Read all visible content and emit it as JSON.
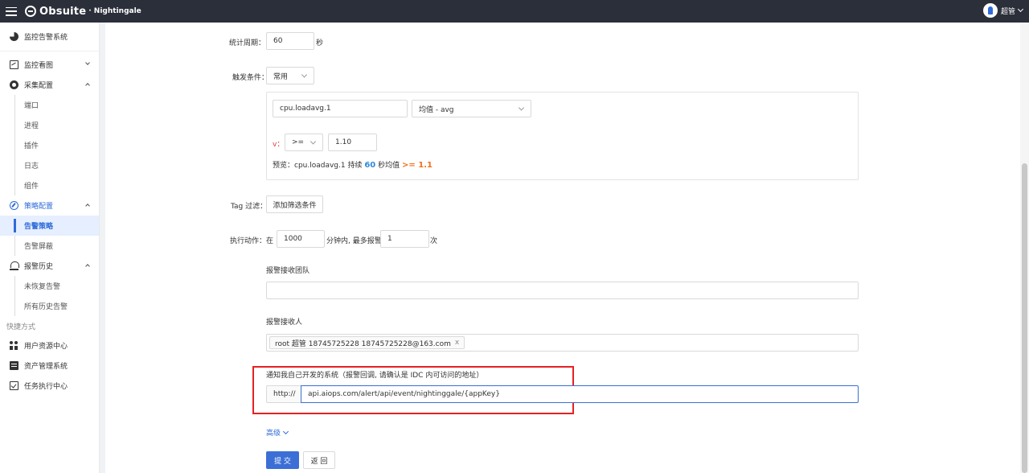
{
  "header": {
    "brand": "Obsuite",
    "brand_sub": "· Nightingale",
    "user_name": "超管"
  },
  "sidebar": {
    "title": "监控告警系统",
    "groups": [
      {
        "label": "监控看图",
        "icon": "chart-monitor-icon",
        "expanded": false
      },
      {
        "label": "采集配置",
        "icon": "collect-icon",
        "expanded": true,
        "items": [
          "端口",
          "进程",
          "插件",
          "日志",
          "组件"
        ]
      },
      {
        "label": "策略配置",
        "icon": "compass-icon",
        "expanded": true,
        "active": true,
        "items": [
          "告警策略",
          "告警屏蔽"
        ],
        "active_item": "告警策略"
      },
      {
        "label": "报警历史",
        "icon": "history-icon",
        "expanded": true,
        "items": [
          "未恢复告警",
          "所有历史告警"
        ]
      }
    ],
    "shortcut_label": "快捷方式",
    "shortcuts": [
      {
        "label": "用户资源中心",
        "icon": "users-icon"
      },
      {
        "label": "资产管理系统",
        "icon": "asset-icon"
      },
      {
        "label": "任务执行中心",
        "icon": "task-icon"
      }
    ]
  },
  "form": {
    "period_label": "统计周期：",
    "period_value": "60",
    "period_unit": "秒",
    "trigger_label": "触发条件：",
    "trigger_mode": "常用",
    "metric": "cpu.loadavg.1",
    "func": "均值 - avg",
    "v_label": "v：",
    "operator": ">=",
    "threshold": "1.10",
    "preview_prefix": "预览：cpu.loadavg.1  持续",
    "preview_seconds": "60",
    "preview_mid": "秒均值",
    "preview_cond": ">= 1.1",
    "tag_label": "Tag 过滤：",
    "tag_button": "添加筛选条件",
    "action_label": "执行动作：",
    "action_in": "在",
    "action_minutes": "1000",
    "action_mid": "分钟内, 最多报警",
    "action_times": "1",
    "action_unit": "次",
    "team_label": "报警接收团队",
    "team_value": "",
    "receiver_label": "报警接收人",
    "receiver_tag": "root 超管 18745725228 18745725228@163.com",
    "receiver_tag_close": "x",
    "callback_label": "通知我自己开发的系统（报警回调, 请确认是 IDC 内可访问的地址）",
    "callback_prefix": "http://",
    "callback_value": "api.aiops.com/alert/api/event/nightinggale/{appKey}",
    "advanced": "高级",
    "submit": "提 交",
    "back": "返 回"
  },
  "colors": {
    "topbar": "#2b2f3a",
    "primary": "#3b6fd6",
    "highlight_box": "#e52222",
    "preview_seconds": "#2f8bd9",
    "preview_cond": "#f0701c"
  }
}
